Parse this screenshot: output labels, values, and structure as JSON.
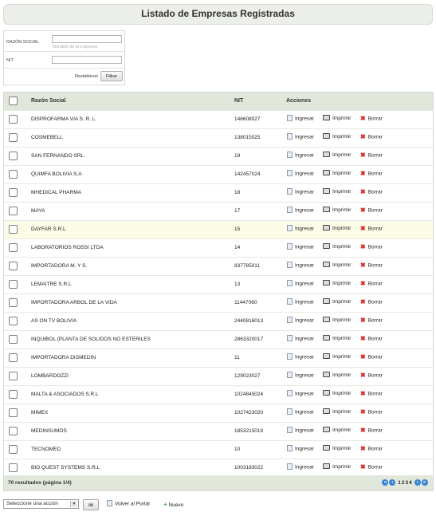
{
  "page_title": "Listado de Empresas Registradas",
  "filters": {
    "razon_social_label": "RAZÓN SOCIAL",
    "razon_social_value": "",
    "razon_social_hint": "Nombre de la empresa",
    "nit_label": "NIT",
    "nit_value": "",
    "reset_label": "Restablecer",
    "filter_label": "Filtrar"
  },
  "table": {
    "headers": {
      "name": "Razón Social",
      "nit": "NIT",
      "actions": "Acciones"
    },
    "action_labels": {
      "enter": "Ingresar",
      "print": "Imprimir",
      "delete": "Borrar"
    },
    "rows": [
      {
        "name": "DISPROFARMA VIA S. R. L.",
        "nit": "146608027"
      },
      {
        "name": "COSMEBELL",
        "nit": "138015025"
      },
      {
        "name": "SAN FERNANDO SRL.",
        "nit": "19"
      },
      {
        "name": "QUIMFA BOLIVIA S.A",
        "nit": "142457024"
      },
      {
        "name": "MHEDICAL PHARMA",
        "nit": "18"
      },
      {
        "name": "MAYA",
        "nit": "17"
      },
      {
        "name": "DAYFAR S.R.L",
        "nit": "15",
        "highlighted": true
      },
      {
        "name": "LABORATORIOS ROSSI LTDA",
        "nit": "14"
      },
      {
        "name": "IMPORTADORA M. Y S.",
        "nit": "837785011"
      },
      {
        "name": "LEMAITRE S.R.L",
        "nit": "13"
      },
      {
        "name": "IMPORTADORA ARBOL DE LA VIDA",
        "nit": "11447060"
      },
      {
        "name": "AS ON TV BOLIVIA",
        "nit": "2440816013"
      },
      {
        "name": "INQUIBOL (PLANTA DE SOLIDOS NO ESTERILES",
        "nit": "2863320017"
      },
      {
        "name": "IMPORTADORA DISMEDIN",
        "nit": "11"
      },
      {
        "name": "LOMBARDOZZI",
        "nit": "129023027"
      },
      {
        "name": "MALTA & ASOCIADOS S.R.L",
        "nit": "1024845024"
      },
      {
        "name": "MIMEX",
        "nit": "1027423020"
      },
      {
        "name": "MEDINSUMOS",
        "nit": "1853215019"
      },
      {
        "name": "TECNOMED",
        "nit": "10"
      },
      {
        "name": "BIO QUEST SYSTEMS S.R.L",
        "nit": "1003183022"
      }
    ],
    "footer_text": "70 resultados (página 1/4)"
  },
  "pager": {
    "pages": [
      "1",
      "2",
      "3",
      "4"
    ],
    "current": "1"
  },
  "bottom": {
    "action_select": "Seleccione una acción",
    "ok_label": "ok",
    "back_label": "Volver al Portal",
    "new_label": "Nuevo"
  }
}
